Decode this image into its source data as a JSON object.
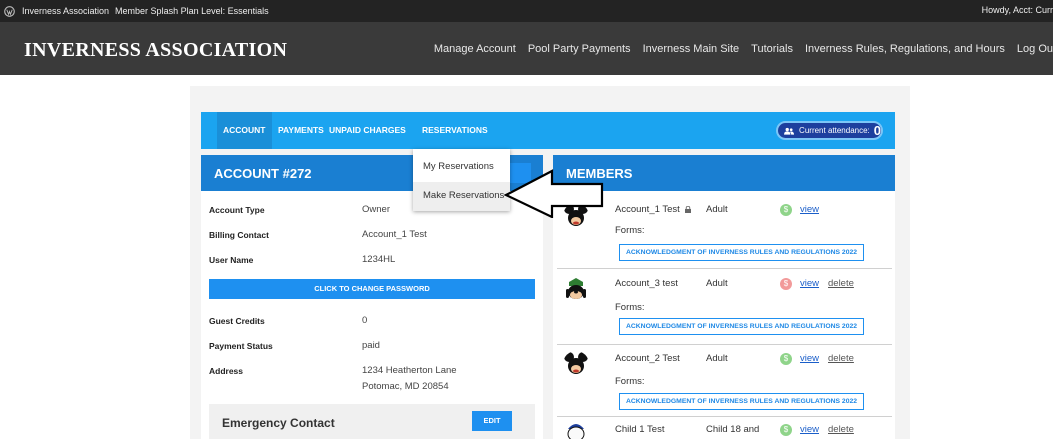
{
  "adminbar": {
    "site_name": "Inverness Association",
    "plan": "Member Splash Plan Level: Essentials",
    "howdy": "Howdy, Acct: Curr"
  },
  "header": {
    "logo": "INVERNESS ASSOCIATION",
    "nav": [
      "Manage Account",
      "Pool Party Payments",
      "Inverness Main Site",
      "Tutorials",
      "Inverness Rules, Regulations, and Hours",
      "Log Ou"
    ]
  },
  "tabs": {
    "account": "ACCOUNT",
    "payments": "PAYMENTS",
    "unpaid": "UNPAID CHARGES",
    "reservations": "RESERVATIONS"
  },
  "attendance": {
    "label": "Current attendance:",
    "count": "0"
  },
  "dropdown": {
    "items": [
      "My Reservations",
      "Make Reservations"
    ]
  },
  "account": {
    "title": "ACCOUNT #272",
    "rows": [
      {
        "label": "Account Type",
        "value": "Owner"
      },
      {
        "label": "Billing Contact",
        "value": "Account_1 Test"
      },
      {
        "label": "User Name",
        "value": "1234HL"
      },
      {
        "label": "Guest Credits",
        "value": "0"
      },
      {
        "label": "Payment Status",
        "value": "paid"
      },
      {
        "label": "Address",
        "value": "1234 Heatherton Lane",
        "value2": "Potomac, MD 20854"
      }
    ],
    "password_button": "CLICK TO CHANGE PASSWORD",
    "emergency_title": "Emergency Contact",
    "emergency_edit": "EDIT"
  },
  "members": {
    "title": "MEMBERS",
    "forms_label": "Forms:",
    "form_button": "ACKNOWLEDGMENT OF INVERNESS RULES AND REGULATIONS 2022",
    "view_label": "view",
    "delete_label": "delete",
    "list": [
      {
        "name": "Account_1 Test",
        "type": "Adult",
        "status_color": "#8fd48a"
      },
      {
        "name": "Account_3 test",
        "type": "Adult",
        "status_color": "#f29a9a"
      },
      {
        "name": "Account_2 Test",
        "type": "Adult",
        "status_color": "#8fd48a"
      },
      {
        "name": "Child 1 Test",
        "type": "Child 18 and",
        "status_color": "#8fd48a"
      }
    ]
  },
  "colors": {
    "tab_bar": "#1ba4f0",
    "panel_header": "#1a7fd2",
    "button": "#1e90f0",
    "header_bg": "#3a3a3a",
    "adminbar_bg": "#232323"
  }
}
